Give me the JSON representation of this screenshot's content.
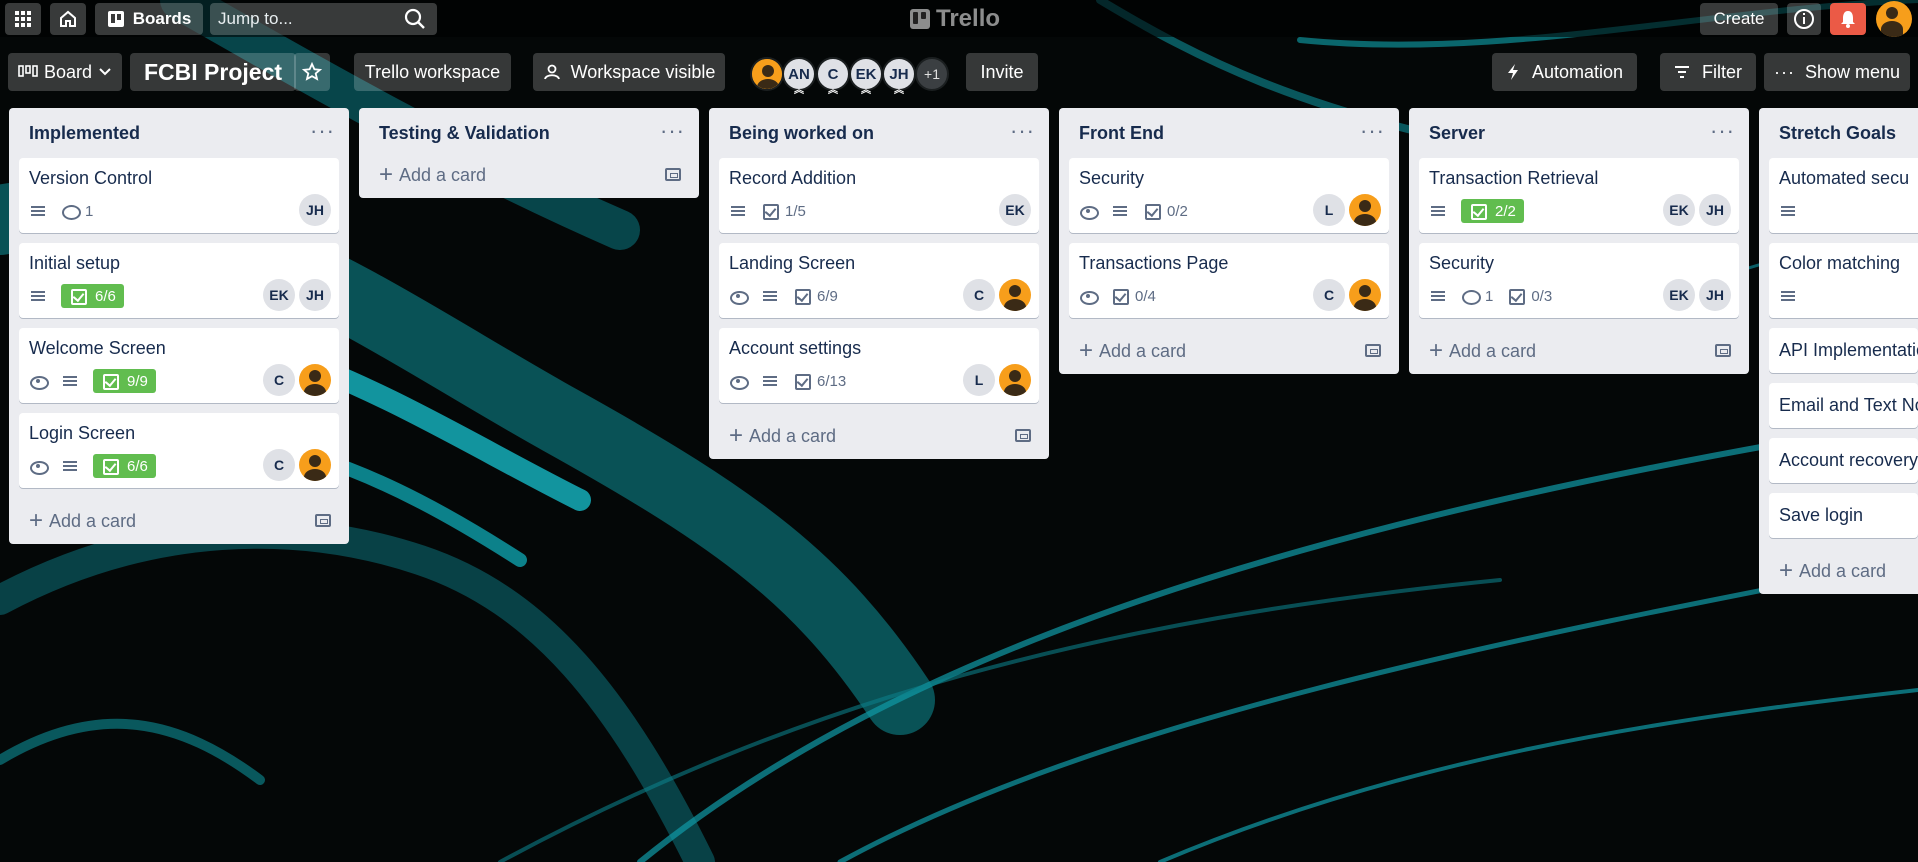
{
  "colors": {
    "accent_cyan": "#11a8b4",
    "list_bg": "#ebecf0",
    "done_badge": "#61bd4f",
    "notification": "#eb5a46",
    "avatar_orange": "#f79e1b"
  },
  "topnav": {
    "boards_label": "Boards",
    "search_placeholder": "Jump to...",
    "logo": "Trello",
    "create_label": "Create"
  },
  "board_header": {
    "view_label": "Board",
    "title": "FCBI Project",
    "workspace_label": "Trello workspace",
    "visibility_label": "Workspace visible",
    "members": [
      "AN",
      "C",
      "EK",
      "JH"
    ],
    "more_members": "+1",
    "invite_label": "Invite",
    "automation_label": "Automation",
    "filter_label": "Filter",
    "show_menu_label": "Show menu"
  },
  "lists": [
    {
      "title": "Implemented",
      "cards": [
        {
          "title": "Version Control",
          "comments": "1",
          "avatars": [
            "JH"
          ]
        },
        {
          "title": "Initial setup",
          "checklist": "6/6",
          "avatars": [
            "EK",
            "JH"
          ]
        },
        {
          "title": "Welcome Screen",
          "checklist": "9/9",
          "avatars": [
            "C"
          ]
        },
        {
          "title": "Login Screen",
          "checklist": "6/6",
          "avatars": [
            "C"
          ]
        }
      ],
      "add_label": "Add a card"
    },
    {
      "title": "Testing & Validation",
      "cards": [],
      "add_label": "Add a card"
    },
    {
      "title": "Being worked on",
      "cards": [
        {
          "title": "Record Addition",
          "checklist": "1/5",
          "avatars": [
            "EK"
          ]
        },
        {
          "title": "Landing Screen",
          "checklist": "6/9",
          "avatars": [
            "C"
          ]
        },
        {
          "title": "Account settings",
          "checklist": "6/13",
          "avatars": [
            "L"
          ]
        }
      ],
      "add_label": "Add a card"
    },
    {
      "title": "Front End",
      "cards": [
        {
          "title": "Security",
          "checklist": "0/2",
          "avatars": [
            "L"
          ]
        },
        {
          "title": "Transactions Page",
          "checklist": "0/4",
          "avatars": [
            "C"
          ]
        }
      ],
      "add_label": "Add a card"
    },
    {
      "title": "Server",
      "cards": [
        {
          "title": "Transaction Retrieval",
          "checklist": "2/2",
          "avatars": [
            "EK",
            "JH"
          ]
        },
        {
          "title": "Security",
          "comments": "1",
          "checklist": "0/3",
          "avatars": [
            "EK",
            "JH"
          ]
        }
      ],
      "add_label": "Add a card"
    },
    {
      "title": "Stretch Goals",
      "cards": [
        {
          "title": "Automated securit"
        },
        {
          "title": "Color matching"
        },
        {
          "title": "API Implementatio"
        },
        {
          "title": "Email and Text No"
        },
        {
          "title": "Account recovery"
        },
        {
          "title": "Save login"
        }
      ],
      "add_label": "Add a card"
    }
  ]
}
